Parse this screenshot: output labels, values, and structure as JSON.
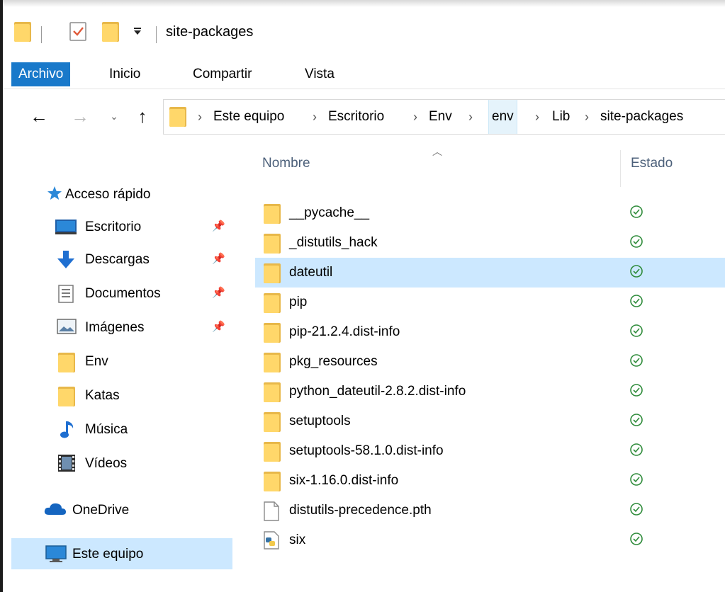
{
  "window": {
    "title": "site-packages"
  },
  "ribbon": {
    "tabs": [
      {
        "label": "Archivo",
        "active": true
      },
      {
        "label": "Inicio"
      },
      {
        "label": "Compartir"
      },
      {
        "label": "Vista"
      }
    ]
  },
  "address": {
    "crumbs": [
      "Este equipo",
      "Escritorio",
      "Env",
      "env",
      "Lib",
      "site-packages"
    ],
    "highlighted_crumb": "env"
  },
  "nav": {
    "quick_access": "Acceso rápido",
    "items": [
      {
        "label": "Escritorio",
        "icon": "desktop-icon",
        "pinned": true
      },
      {
        "label": "Descargas",
        "icon": "download-arrow-icon",
        "pinned": true
      },
      {
        "label": "Documentos",
        "icon": "document-icon",
        "pinned": true
      },
      {
        "label": "Imágenes",
        "icon": "pictures-icon",
        "pinned": true
      },
      {
        "label": "Env",
        "icon": "folder-icon"
      },
      {
        "label": "Katas",
        "icon": "folder-icon"
      },
      {
        "label": "Música",
        "icon": "music-note-icon"
      },
      {
        "label": "Vídeos",
        "icon": "film-icon"
      }
    ],
    "onedrive": "OneDrive",
    "this_pc": "Este equipo"
  },
  "list": {
    "columns": {
      "name": "Nombre",
      "status": "Estado"
    },
    "files": [
      {
        "name": "__pycache__",
        "type": "folder"
      },
      {
        "name": "_distutils_hack",
        "type": "folder"
      },
      {
        "name": "dateutil",
        "type": "folder",
        "selected": true
      },
      {
        "name": "pip",
        "type": "folder"
      },
      {
        "name": "pip-21.2.4.dist-info",
        "type": "folder"
      },
      {
        "name": "pkg_resources",
        "type": "folder"
      },
      {
        "name": "python_dateutil-2.8.2.dist-info",
        "type": "folder"
      },
      {
        "name": "setuptools",
        "type": "folder"
      },
      {
        "name": "setuptools-58.1.0.dist-info",
        "type": "folder"
      },
      {
        "name": "six-1.16.0.dist-info",
        "type": "folder"
      },
      {
        "name": "distutils-precedence.pth",
        "type": "file"
      },
      {
        "name": "six",
        "type": "python"
      }
    ],
    "status_icon": "synced-check-icon"
  },
  "colors": {
    "accent": "#1979ca",
    "folder": "#ffd76a",
    "selection": "#cce8ff",
    "status_green": "#2e8b3a"
  }
}
